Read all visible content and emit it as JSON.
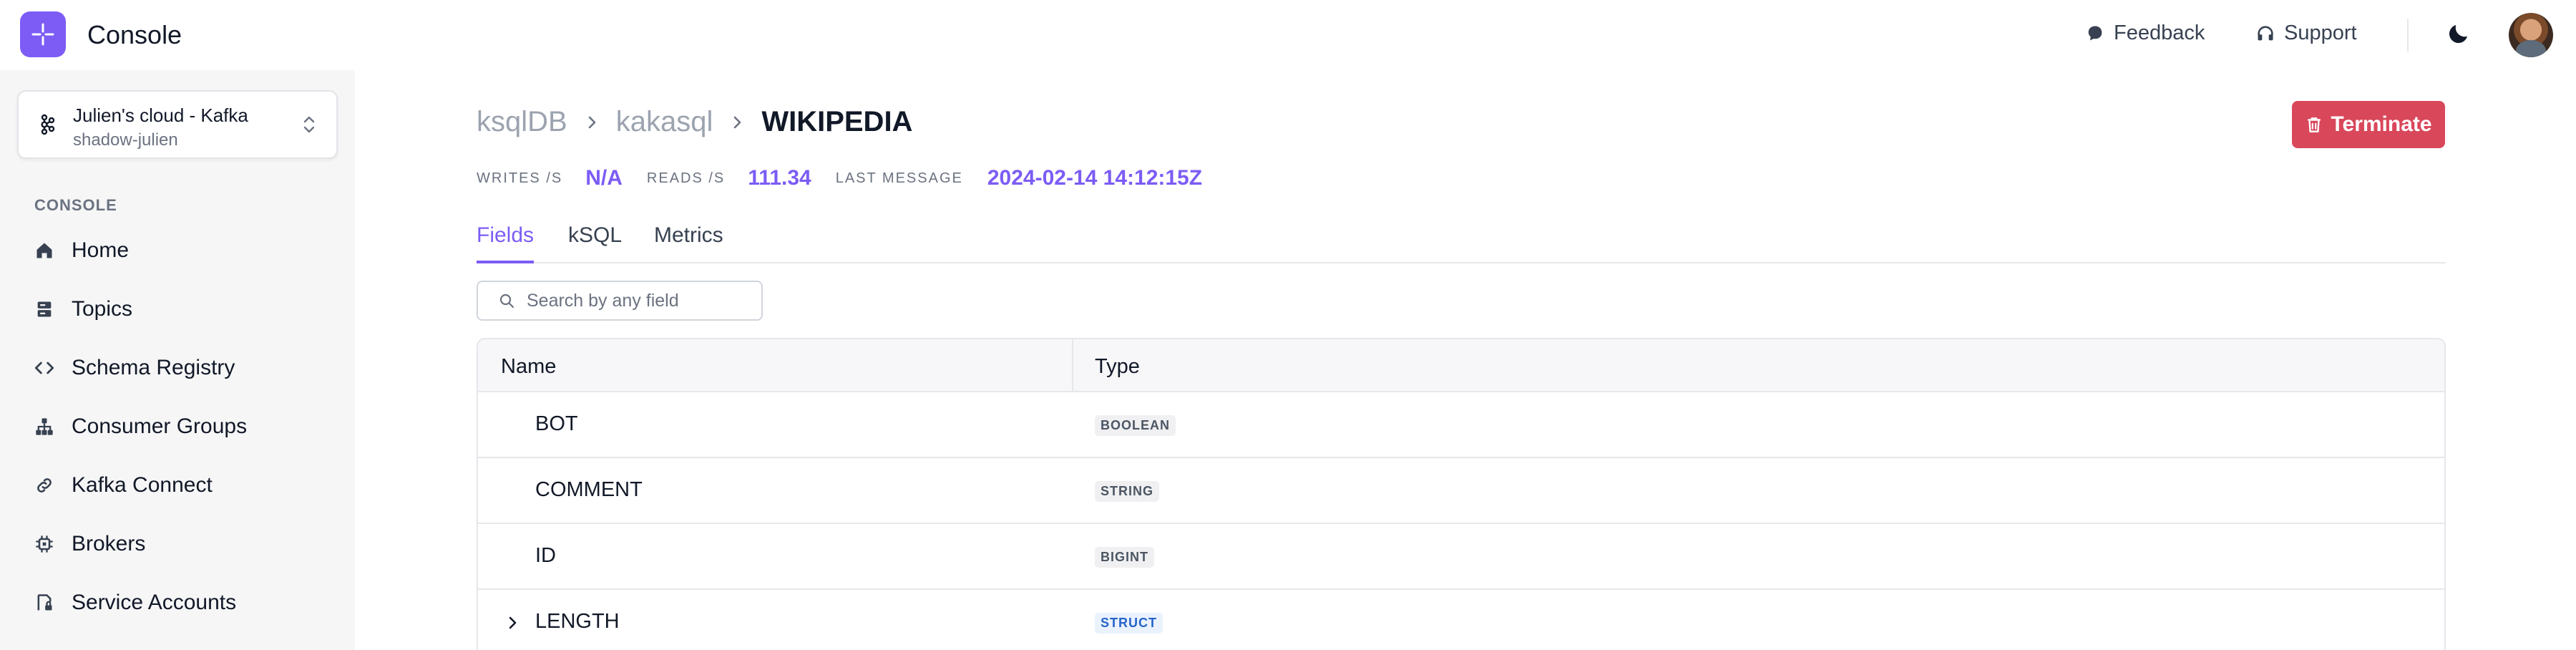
{
  "app": {
    "title": "Console"
  },
  "header": {
    "feedback_label": "Feedback",
    "support_label": "Support"
  },
  "sidebar": {
    "cluster": {
      "name": "Julien's cloud - Kafka",
      "subtitle": "shadow-julien"
    },
    "section_label": "CONSOLE",
    "items": [
      {
        "label": "Home",
        "icon": "home-icon"
      },
      {
        "label": "Topics",
        "icon": "topics-icon"
      },
      {
        "label": "Schema Registry",
        "icon": "code-icon"
      },
      {
        "label": "Consumer Groups",
        "icon": "groups-icon"
      },
      {
        "label": "Kafka Connect",
        "icon": "link-icon"
      },
      {
        "label": "Brokers",
        "icon": "chip-icon"
      },
      {
        "label": "Service Accounts",
        "icon": "account-lock-icon"
      }
    ]
  },
  "breadcrumb": {
    "items": [
      "ksqlDB",
      "kakasql"
    ],
    "current": "WIKIPEDIA"
  },
  "actions": {
    "terminate_label": "Terminate"
  },
  "stats": {
    "writes_label": "WRITES /S",
    "writes_value": "N/A",
    "reads_label": "READS /S",
    "reads_value": "111.34",
    "last_message_label": "LAST MESSAGE",
    "last_message_value": "2024-02-14 14:12:15Z"
  },
  "tabs": [
    {
      "label": "Fields",
      "active": true
    },
    {
      "label": "kSQL",
      "active": false
    },
    {
      "label": "Metrics",
      "active": false
    }
  ],
  "search": {
    "placeholder": "Search by any field",
    "value": ""
  },
  "table": {
    "columns": [
      "Name",
      "Type"
    ],
    "rows": [
      {
        "name": "BOT",
        "type": "BOOLEAN",
        "expandable": false
      },
      {
        "name": "COMMENT",
        "type": "STRING",
        "expandable": false
      },
      {
        "name": "ID",
        "type": "BIGINT",
        "expandable": false
      },
      {
        "name": "LENGTH",
        "type": "STRUCT",
        "expandable": true
      }
    ]
  },
  "colors": {
    "accent": "#7c5cf5",
    "danger": "#d9475b",
    "struct_badge": "#2563c9"
  }
}
